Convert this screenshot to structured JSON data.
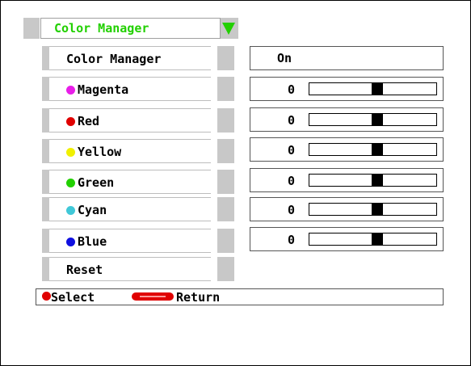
{
  "header": {
    "title": "Color Manager"
  },
  "menu": {
    "items": [
      {
        "label": "Color Manager",
        "dot_color": null,
        "value": "On",
        "type": "text"
      },
      {
        "label": "Magenta",
        "dot_color": "#e81ee8",
        "value": "0",
        "type": "slider",
        "level": 0.5
      },
      {
        "label": "Red",
        "dot_color": "#e00000",
        "value": "0",
        "type": "slider",
        "level": 0.5
      },
      {
        "label": "Yellow",
        "dot_color": "#f0f000",
        "value": "0",
        "type": "slider",
        "level": 0.5
      },
      {
        "label": "Green",
        "dot_color": "#22d000",
        "value": "0",
        "type": "slider",
        "level": 0.5
      },
      {
        "label": "Cyan",
        "dot_color": "#40c8d8",
        "value": "0",
        "type": "slider",
        "level": 0.5
      },
      {
        "label": "Blue",
        "dot_color": "#1010e0",
        "value": "0",
        "type": "slider",
        "level": 0.5
      },
      {
        "label": "Reset",
        "dot_color": null,
        "type": "action"
      }
    ]
  },
  "footer": {
    "select_label": "Select",
    "return_label": "Return"
  },
  "colors": {
    "accent": "#22d000",
    "button_red": "#e00000",
    "bar_gray": "#c8c8c8"
  }
}
